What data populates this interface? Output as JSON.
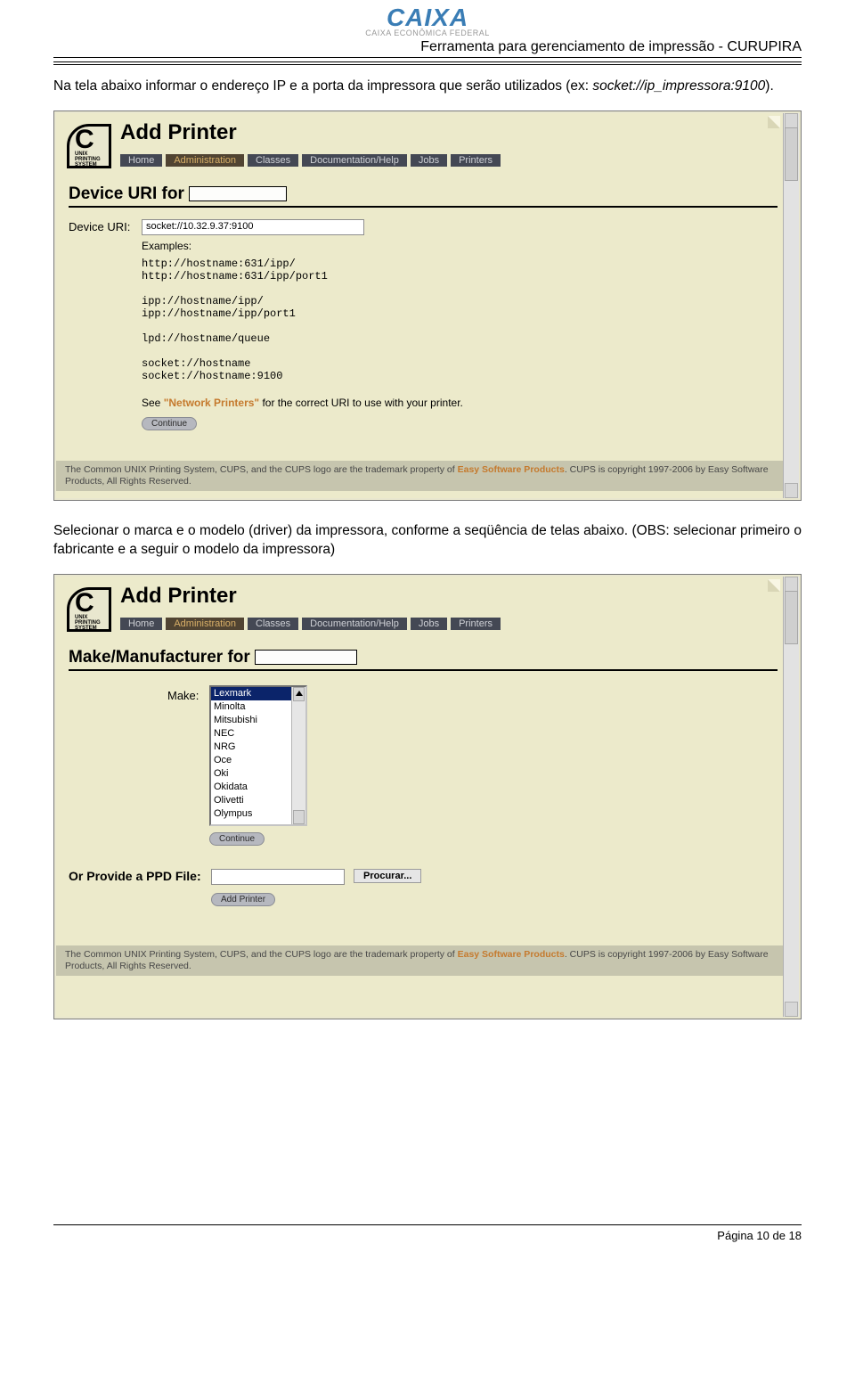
{
  "page_header": {
    "logo_text": "CAIXA",
    "logo_sub": "CAIXA ECONÔMICA FEDERAL",
    "title": "Ferramenta para gerenciamento de impressão - CURUPIRA"
  },
  "para1": "Na tela abaixo informar o endereço IP e a porta da impressora que serão utilizados (ex: ",
  "para1_italic": "socket://ip_impressora:9100",
  "para1_end": ").",
  "para2": "Selecionar o marca e o modelo (driver) da impressora, conforme a seqüência de telas abaixo. (OBS: selecionar primeiro o fabricante e a seguir o modelo da impressora)",
  "cups": {
    "title": "Add Printer",
    "logo_tiny": "UNIX PRINTING SYSTEM",
    "nav": [
      "Home",
      "Administration",
      "Classes",
      "Documentation/Help",
      "Jobs",
      "Printers"
    ],
    "active_nav": "Administration"
  },
  "ss1": {
    "heading": "Device URI for",
    "uri_label": "Device URI:",
    "uri_value": "socket://10.32.9.37:9100",
    "examples_label": "Examples:",
    "examples": "http://hostname:631/ipp/\nhttp://hostname:631/ipp/port1\n\nipp://hostname/ipp/\nipp://hostname/ipp/port1\n\nlpd://hostname/queue\n\nsocket://hostname\nsocket://hostname:9100",
    "see_a": "See ",
    "see_b": "\"Network Printers\"",
    "see_c": " for the correct URI to use with your printer.",
    "continue": "Continue"
  },
  "ss2": {
    "heading": "Make/Manufacturer for",
    "make_label": "Make:",
    "makes": [
      "Lexmark",
      "Minolta",
      "Mitsubishi",
      "NEC",
      "NRG",
      "Oce",
      "Oki",
      "Okidata",
      "Olivetti",
      "Olympus"
    ],
    "selected_make": "Lexmark",
    "continue": "Continue",
    "ppd_label": "Or Provide a PPD File:",
    "browse": "Procurar...",
    "add_printer": "Add Printer"
  },
  "cups_footer_a": "The Common UNIX Printing System, CUPS, and the CUPS logo are the trademark property of ",
  "cups_footer_b": "Easy Software Products",
  "cups_footer_c": ". CUPS is copyright 1997-2006 by Easy Software Products, All Rights Reserved.",
  "page_number": "Página 10 de 18"
}
